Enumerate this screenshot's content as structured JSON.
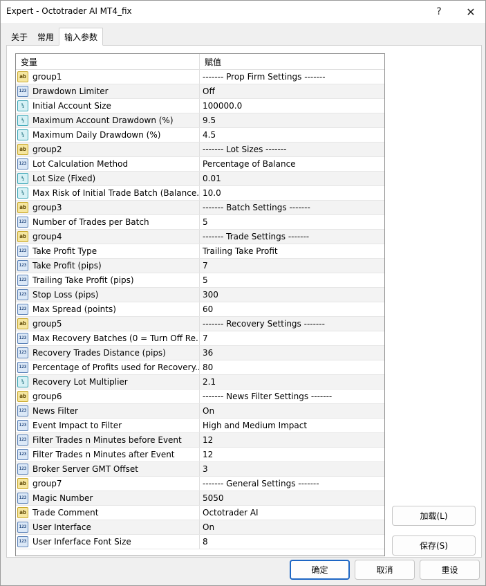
{
  "window": {
    "title": "Expert - Octotrader AI MT4_fix",
    "help_label": "?",
    "close_label": "✕"
  },
  "tabs": [
    {
      "label": "关于",
      "active": false
    },
    {
      "label": "常用",
      "active": false
    },
    {
      "label": "输入参数",
      "active": true
    }
  ],
  "grid": {
    "header": {
      "variable": "变量",
      "value": "赋值"
    },
    "rows": [
      {
        "type": "string",
        "icon_text": "ab",
        "name": "group1",
        "value": "------- Prop Firm Settings -------"
      },
      {
        "type": "int",
        "icon_text": "123",
        "name": "Drawdown Limiter",
        "value": "Off"
      },
      {
        "type": "double",
        "icon_text": "½",
        "name": "Initial Account Size",
        "value": "100000.0"
      },
      {
        "type": "double",
        "icon_text": "½",
        "name": "Maximum Account Drawdown (%)",
        "value": "9.5"
      },
      {
        "type": "double",
        "icon_text": "½",
        "name": "Maximum Daily Drawdown (%)",
        "value": "4.5"
      },
      {
        "type": "string",
        "icon_text": "ab",
        "name": "group2",
        "value": "------- Lot Sizes -------"
      },
      {
        "type": "int",
        "icon_text": "123",
        "name": "Lot Calculation Method",
        "value": "Percentage of Balance"
      },
      {
        "type": "double",
        "icon_text": "½",
        "name": "Lot Size (Fixed)",
        "value": "0.01"
      },
      {
        "type": "double",
        "icon_text": "½",
        "name": "Max Risk of Initial Trade Batch (Balance...",
        "value": "10.0"
      },
      {
        "type": "string",
        "icon_text": "ab",
        "name": "group3",
        "value": "------- Batch Settings -------"
      },
      {
        "type": "int",
        "icon_text": "123",
        "name": "Number of Trades per Batch",
        "value": "5"
      },
      {
        "type": "string",
        "icon_text": "ab",
        "name": "group4",
        "value": "------- Trade Settings -------"
      },
      {
        "type": "int",
        "icon_text": "123",
        "name": "Take Profit Type",
        "value": "Trailing Take Profit"
      },
      {
        "type": "int",
        "icon_text": "123",
        "name": "Take Profit (pips)",
        "value": "7"
      },
      {
        "type": "int",
        "icon_text": "123",
        "name": "Trailing Take Profit (pips)",
        "value": "5"
      },
      {
        "type": "int",
        "icon_text": "123",
        "name": "Stop Loss (pips)",
        "value": "300"
      },
      {
        "type": "int",
        "icon_text": "123",
        "name": "Max Spread (points)",
        "value": "60"
      },
      {
        "type": "string",
        "icon_text": "ab",
        "name": "group5",
        "value": "------- Recovery Settings -------"
      },
      {
        "type": "int",
        "icon_text": "123",
        "name": "Max Recovery Batches (0 = Turn Off Re...",
        "value": "7"
      },
      {
        "type": "int",
        "icon_text": "123",
        "name": "Recovery Trades Distance (pips)",
        "value": "36"
      },
      {
        "type": "int",
        "icon_text": "123",
        "name": "Percentage of Profits used for Recovery...",
        "value": "80"
      },
      {
        "type": "double",
        "icon_text": "½",
        "name": "Recovery Lot Multiplier",
        "value": "2.1"
      },
      {
        "type": "string",
        "icon_text": "ab",
        "name": "group6",
        "value": "------- News Filter Settings -------"
      },
      {
        "type": "int",
        "icon_text": "123",
        "name": "News Filter",
        "value": "On"
      },
      {
        "type": "int",
        "icon_text": "123",
        "name": "Event Impact to Filter",
        "value": "High and Medium Impact"
      },
      {
        "type": "int",
        "icon_text": "123",
        "name": "Filter Trades n Minutes before Event",
        "value": "12"
      },
      {
        "type": "int",
        "icon_text": "123",
        "name": "Filter Trades n Minutes after Event",
        "value": "12"
      },
      {
        "type": "int",
        "icon_text": "123",
        "name": "Broker Server GMT Offset",
        "value": "3"
      },
      {
        "type": "string",
        "icon_text": "ab",
        "name": "group7",
        "value": "------- General Settings -------"
      },
      {
        "type": "int",
        "icon_text": "123",
        "name": "Magic Number",
        "value": "5050"
      },
      {
        "type": "string",
        "icon_text": "ab",
        "name": "Trade Comment",
        "value": "Octotrader AI"
      },
      {
        "type": "int",
        "icon_text": "123",
        "name": "User Interface",
        "value": "On"
      },
      {
        "type": "int",
        "icon_text": "123",
        "name": "User Inferface Font Size",
        "value": "8"
      }
    ]
  },
  "buttons": {
    "load": "加载(L)",
    "save": "保存(S)",
    "ok": "确定",
    "cancel": "取消",
    "reset": "重设"
  },
  "colors": {
    "accent_border": "#1d66c4",
    "alt_row": "#f3f3f3"
  }
}
